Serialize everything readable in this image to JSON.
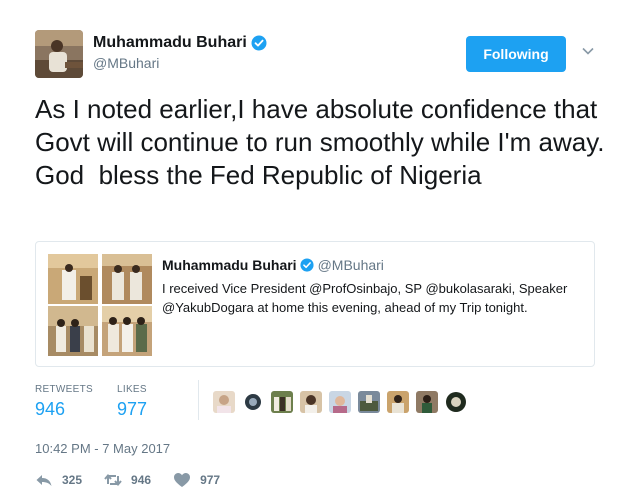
{
  "author": {
    "display_name": "Muhammadu Buhari",
    "handle": "@MBuhari"
  },
  "follow_button": {
    "label": "Following"
  },
  "tweet": {
    "text": "As I noted earlier,I have absolute confidence that Govt will continue to run smoothly while I'm away. God  bless the Fed Republic of Nigeria"
  },
  "quoted_tweet": {
    "display_name": "Muhammadu Buhari",
    "handle": "@MBuhari",
    "text": "I received Vice President @ProfOsinbajo, SP @bukolasaraki, Speaker @YakubDogara at home this evening, ahead of my Trip tonight."
  },
  "stats": {
    "retweets_label": "RETWEETS",
    "retweets_value": "946",
    "likes_label": "LIKES",
    "likes_value": "977"
  },
  "timestamp": "10:42 PM - 7 May 2017",
  "actions": {
    "reply_count": "325",
    "retweet_count": "946",
    "like_count": "977"
  },
  "colors": {
    "accent": "#1da1f2",
    "muted": "#657786",
    "text": "#14171a",
    "border": "#e1e8ed"
  }
}
